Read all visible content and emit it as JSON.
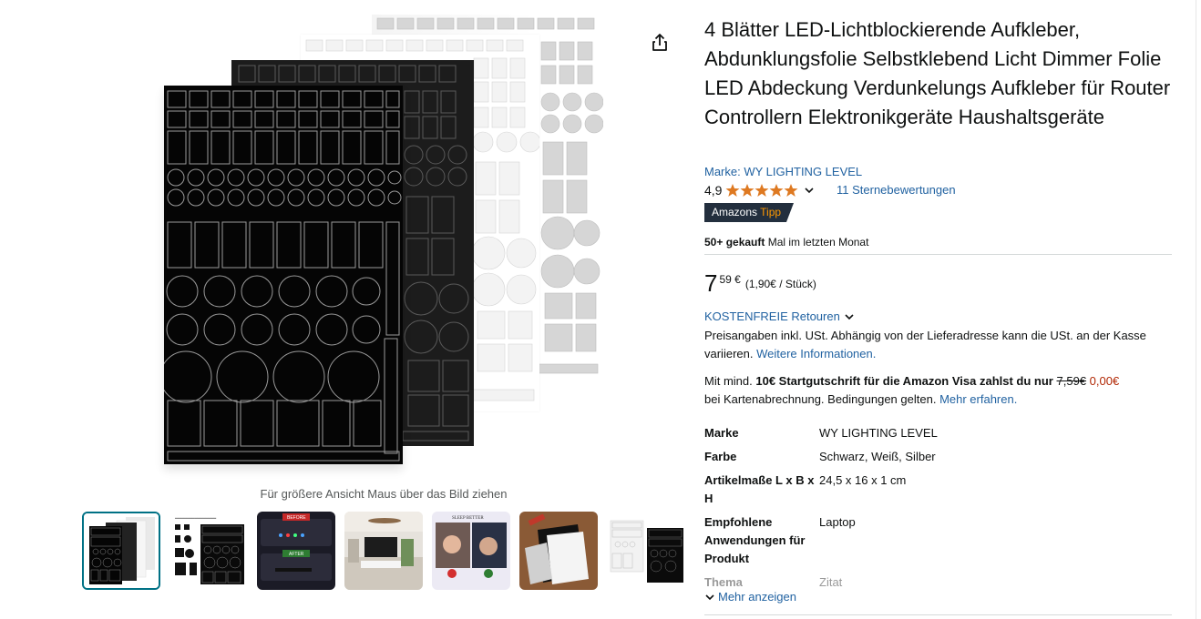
{
  "product": {
    "title": "4 Blätter LED-Lichtblockierende Aufkleber, Abdunklungsfolie Selbstklebend Licht Dimmer Folie LED Abdeckung Verdunkelungs Aufkleber für Router Controllern Elektronikgeräte Haushaltsgeräte",
    "brand_link": "Marke: WY LIGHTING LEVEL",
    "rating": "4,9",
    "stars": 4.9,
    "reviews": "11 Sternebewertungen",
    "badge_prefix": "Amazons",
    "badge_suffix": "Tipp",
    "bought_strong": "50+ gekauft",
    "bought_rest": "Mal im letzten Monat"
  },
  "gallery": {
    "hint": "Für größere Ansicht Maus über das Bild ziehen",
    "thumbnails": [
      "sticker-sheets",
      "size-chart",
      "before-after",
      "living-room",
      "sleep-better",
      "sheets-on-table",
      "four-sheets"
    ],
    "selected_index": 0,
    "before_label": "BEFORE",
    "after_label": "AFTER",
    "sleep_label": "SLEEP BETTER"
  },
  "price": {
    "whole": "7",
    "fraction": "59 €",
    "unit": "(1,90€ / Stück)"
  },
  "returns": "KOSTENFREIE Retouren",
  "tax": {
    "text": "Preisangaben inkl. USt. Abhängig von der Lieferadresse kann die USt. an der Kasse variieren.",
    "link": "Weitere Informationen."
  },
  "promo": {
    "prefix": "Mit mind.",
    "strong": "10€ Startgutschrift für die Amazon Visa zahlst du nur",
    "old_price": "7,59€",
    "new_price": "0,00€",
    "suffix": "bei Kartenabrechnung. Bedingungen gelten.",
    "link": "Mehr erfahren."
  },
  "specs": [
    {
      "key": "Marke",
      "value": "WY LIGHTING LEVEL"
    },
    {
      "key": "Farbe",
      "value": "Schwarz, Weiß, Silber"
    },
    {
      "key": "Artikelmaße L x B x H",
      "value": "24,5 x 16 x 1 cm"
    },
    {
      "key": "Empfohlene Anwendungen für Produkt",
      "value": "Laptop"
    },
    {
      "key": "Thema",
      "value": "Zitat"
    }
  ],
  "more_label": "Mehr anzeigen",
  "colors": {
    "link": "#2162a1",
    "star": "#de7921",
    "badge_bg": "#232f3e",
    "badge_accent": "#ff9900",
    "deal_red": "#b12704",
    "selected_border": "#007185"
  }
}
